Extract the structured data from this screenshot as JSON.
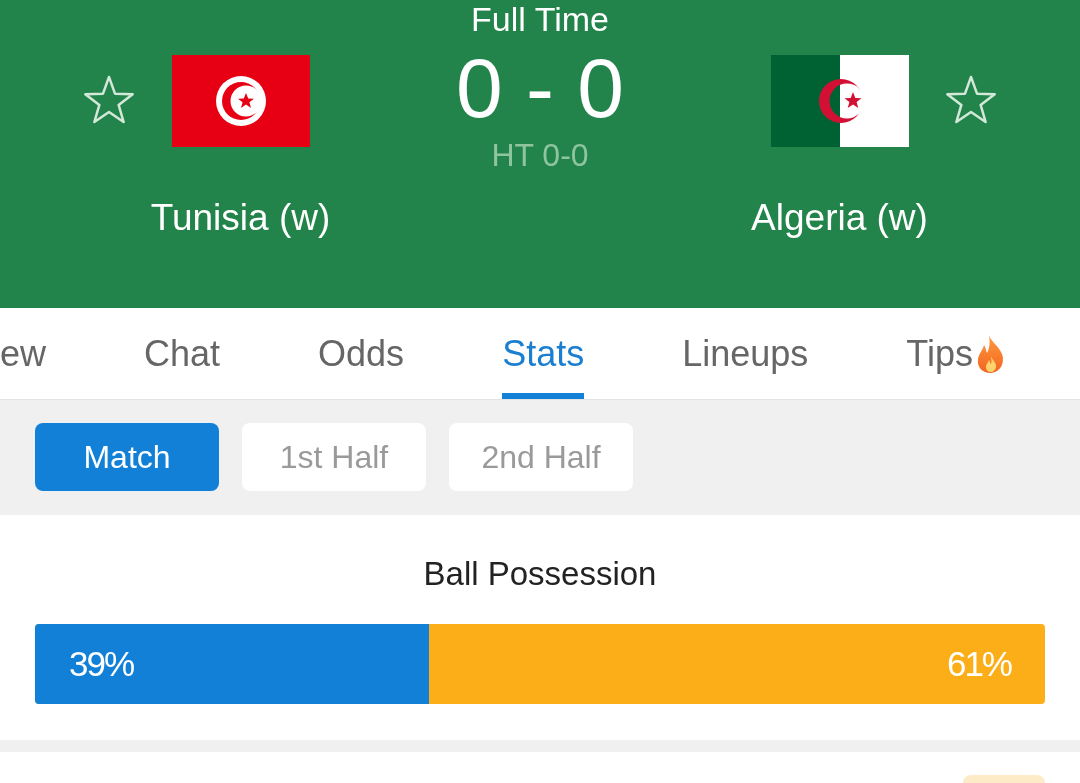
{
  "header": {
    "status": "Full Time",
    "score": "0 - 0",
    "half_time": "HT 0-0",
    "teams": [
      {
        "name": "Tunisia (w)",
        "favorite": false
      },
      {
        "name": "Algeria (w)",
        "favorite": false
      }
    ]
  },
  "tabs": [
    {
      "label": "ew",
      "selected": false,
      "hot": false
    },
    {
      "label": "Chat",
      "selected": false,
      "hot": false
    },
    {
      "label": "Odds",
      "selected": false,
      "hot": false
    },
    {
      "label": "Stats",
      "selected": true,
      "hot": false
    },
    {
      "label": "Lineups",
      "selected": false,
      "hot": false
    },
    {
      "label": "Tips",
      "selected": false,
      "hot": true
    }
  ],
  "periods": [
    {
      "label": "Match",
      "selected": true
    },
    {
      "label": "1st Half",
      "selected": false
    },
    {
      "label": "2nd Half",
      "selected": false
    }
  ],
  "stats": [
    {
      "title": "Ball Possession",
      "home_value": "39%",
      "away_value": "61%",
      "level": 0.39
    }
  ]
}
